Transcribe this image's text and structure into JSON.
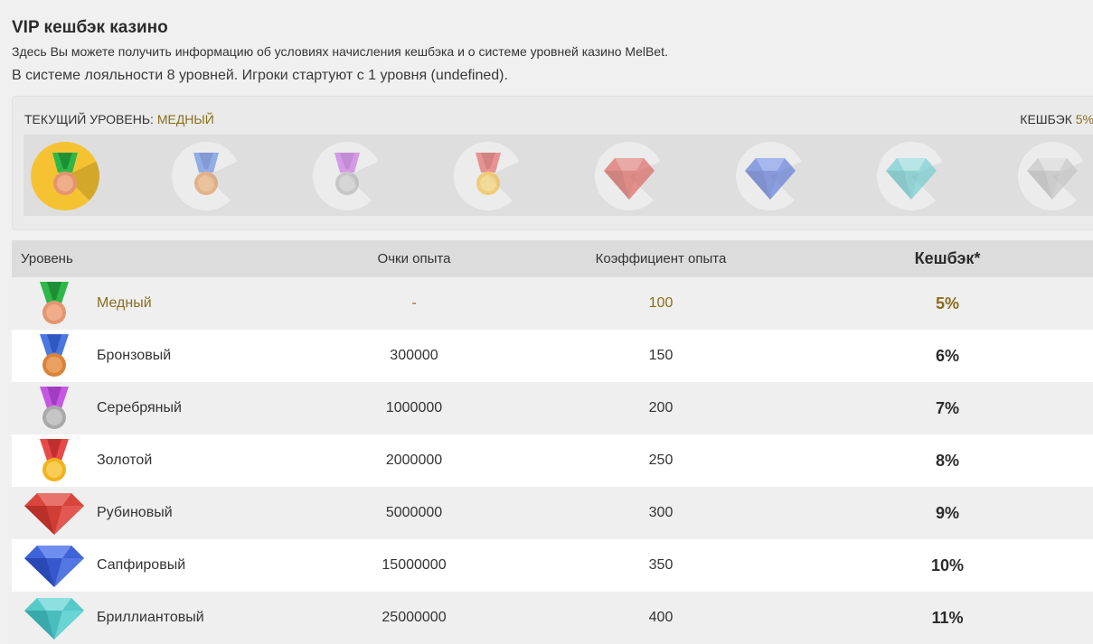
{
  "page": {
    "title": "VIP кешбэк казино",
    "subtitle": "Здесь Вы можете получить информацию об условиях начисления кешбэка и о системе уровней казино MelBet.",
    "info": "В системе лояльности 8 уровней. Игроки стартуют с 1 уровня (undefined)."
  },
  "status": {
    "current_label": "ТЕКУЩИЙ УРОВЕНЬ:",
    "current_value": "МЕДНЫЙ",
    "cashback_label": "КЕШБЭК",
    "cashback_value": "5%"
  },
  "badges": [
    {
      "icon": "medal-copper-icon",
      "active": true
    },
    {
      "icon": "medal-bronze-icon",
      "active": false
    },
    {
      "icon": "medal-silver-icon",
      "active": false
    },
    {
      "icon": "medal-gold-icon",
      "active": false
    },
    {
      "icon": "ruby-gem-icon",
      "active": false
    },
    {
      "icon": "sapphire-gem-icon",
      "active": false
    },
    {
      "icon": "diamond-gem-icon",
      "active": false
    },
    {
      "icon": "platinum-gem-icon",
      "active": false
    }
  ],
  "table": {
    "headers": {
      "level": "Уровень",
      "points": "Очки опыта",
      "coef": "Коэффициент опыта",
      "cashback": "Кешбэк*"
    },
    "rows": [
      {
        "name": "Медный",
        "points": "-",
        "coef": "100",
        "cashback": "5%",
        "icon": "medal-copper-icon"
      },
      {
        "name": "Бронзовый",
        "points": "300000",
        "coef": "150",
        "cashback": "6%",
        "icon": "medal-bronze-icon"
      },
      {
        "name": "Серебряный",
        "points": "1000000",
        "coef": "200",
        "cashback": "7%",
        "icon": "medal-silver-icon"
      },
      {
        "name": "Золотой",
        "points": "2000000",
        "coef": "250",
        "cashback": "8%",
        "icon": "medal-gold-icon"
      },
      {
        "name": "Рубиновый",
        "points": "5000000",
        "coef": "300",
        "cashback": "9%",
        "icon": "ruby-gem-icon"
      },
      {
        "name": "Сапфировый",
        "points": "15000000",
        "coef": "350",
        "cashback": "10%",
        "icon": "sapphire-gem-icon"
      },
      {
        "name": "Бриллиантовый",
        "points": "25000000",
        "coef": "400",
        "cashback": "11%",
        "icon": "diamond-gem-icon"
      }
    ]
  },
  "colors": {
    "accent": "#8a6d1c",
    "active_badge": "#f5c332",
    "header_bg": "#dcdcdc"
  }
}
